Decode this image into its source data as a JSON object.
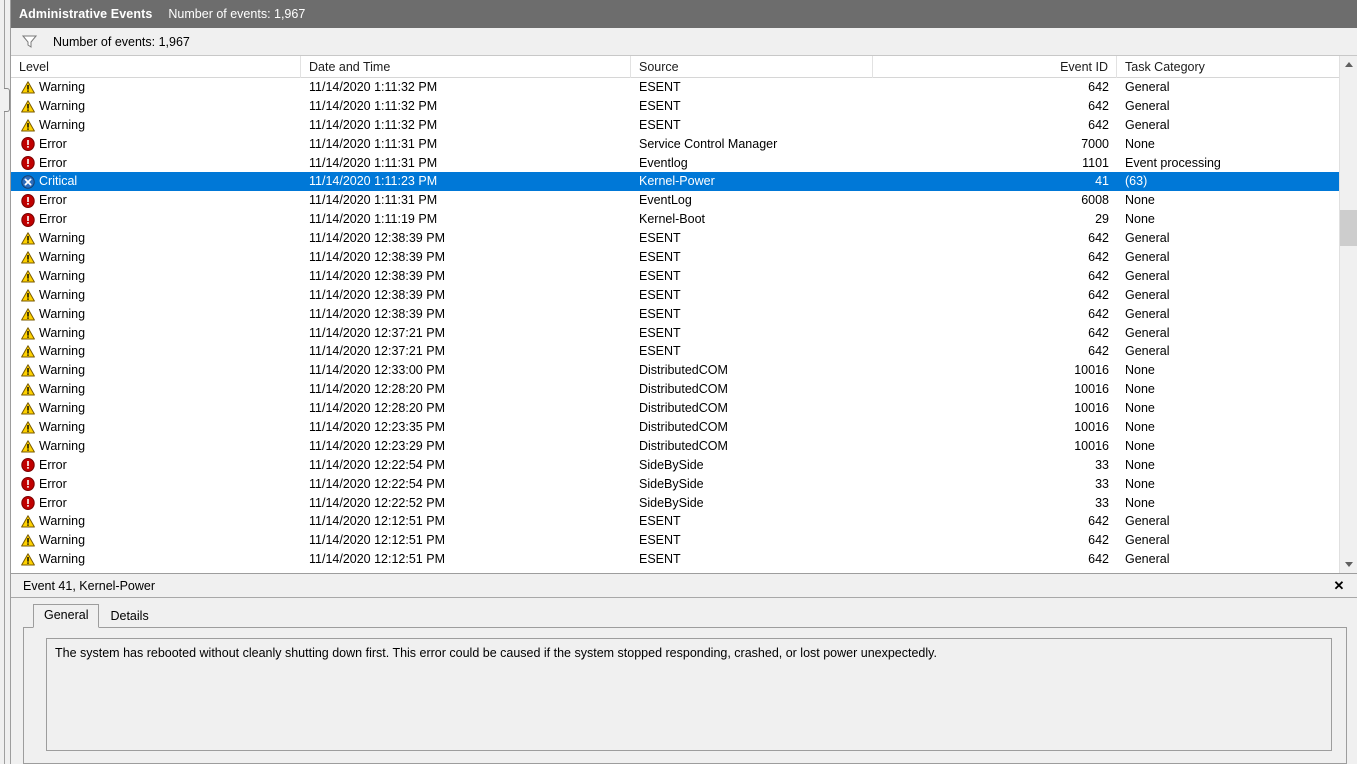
{
  "titlebar": {
    "title": "Administrative Events",
    "subtitle": "Number of events: 1,967"
  },
  "filterbar": {
    "icon": "filter-funnel-icon",
    "count_label": "Number of events: 1,967"
  },
  "grid": {
    "columns": [
      {
        "key": "level",
        "label": "Level",
        "align": "left"
      },
      {
        "key": "date",
        "label": "Date and Time",
        "align": "left"
      },
      {
        "key": "source",
        "label": "Source",
        "align": "left"
      },
      {
        "key": "eventid",
        "label": "Event ID",
        "align": "right"
      },
      {
        "key": "task",
        "label": "Task Category",
        "align": "left"
      }
    ],
    "rows": [
      {
        "level": "Warning",
        "icon": "warning-icon",
        "date": "11/14/2020 1:11:32 PM",
        "source": "ESENT",
        "eventid": "642",
        "task": "General",
        "selected": false
      },
      {
        "level": "Warning",
        "icon": "warning-icon",
        "date": "11/14/2020 1:11:32 PM",
        "source": "ESENT",
        "eventid": "642",
        "task": "General",
        "selected": false
      },
      {
        "level": "Warning",
        "icon": "warning-icon",
        "date": "11/14/2020 1:11:32 PM",
        "source": "ESENT",
        "eventid": "642",
        "task": "General",
        "selected": false
      },
      {
        "level": "Error",
        "icon": "error-icon",
        "date": "11/14/2020 1:11:31 PM",
        "source": "Service Control Manager",
        "eventid": "7000",
        "task": "None",
        "selected": false
      },
      {
        "level": "Error",
        "icon": "error-icon",
        "date": "11/14/2020 1:11:31 PM",
        "source": "Eventlog",
        "eventid": "1101",
        "task": "Event processing",
        "selected": false
      },
      {
        "level": "Critical",
        "icon": "critical-icon",
        "date": "11/14/2020 1:11:23 PM",
        "source": "Kernel-Power",
        "eventid": "41",
        "task": "(63)",
        "selected": true
      },
      {
        "level": "Error",
        "icon": "error-icon",
        "date": "11/14/2020 1:11:31 PM",
        "source": "EventLog",
        "eventid": "6008",
        "task": "None",
        "selected": false
      },
      {
        "level": "Error",
        "icon": "error-icon",
        "date": "11/14/2020 1:11:19 PM",
        "source": "Kernel-Boot",
        "eventid": "29",
        "task": "None",
        "selected": false
      },
      {
        "level": "Warning",
        "icon": "warning-icon",
        "date": "11/14/2020 12:38:39 PM",
        "source": "ESENT",
        "eventid": "642",
        "task": "General",
        "selected": false
      },
      {
        "level": "Warning",
        "icon": "warning-icon",
        "date": "11/14/2020 12:38:39 PM",
        "source": "ESENT",
        "eventid": "642",
        "task": "General",
        "selected": false
      },
      {
        "level": "Warning",
        "icon": "warning-icon",
        "date": "11/14/2020 12:38:39 PM",
        "source": "ESENT",
        "eventid": "642",
        "task": "General",
        "selected": false
      },
      {
        "level": "Warning",
        "icon": "warning-icon",
        "date": "11/14/2020 12:38:39 PM",
        "source": "ESENT",
        "eventid": "642",
        "task": "General",
        "selected": false
      },
      {
        "level": "Warning",
        "icon": "warning-icon",
        "date": "11/14/2020 12:38:39 PM",
        "source": "ESENT",
        "eventid": "642",
        "task": "General",
        "selected": false
      },
      {
        "level": "Warning",
        "icon": "warning-icon",
        "date": "11/14/2020 12:37:21 PM",
        "source": "ESENT",
        "eventid": "642",
        "task": "General",
        "selected": false
      },
      {
        "level": "Warning",
        "icon": "warning-icon",
        "date": "11/14/2020 12:37:21 PM",
        "source": "ESENT",
        "eventid": "642",
        "task": "General",
        "selected": false
      },
      {
        "level": "Warning",
        "icon": "warning-icon",
        "date": "11/14/2020 12:33:00 PM",
        "source": "DistributedCOM",
        "eventid": "10016",
        "task": "None",
        "selected": false
      },
      {
        "level": "Warning",
        "icon": "warning-icon",
        "date": "11/14/2020 12:28:20 PM",
        "source": "DistributedCOM",
        "eventid": "10016",
        "task": "None",
        "selected": false
      },
      {
        "level": "Warning",
        "icon": "warning-icon",
        "date": "11/14/2020 12:28:20 PM",
        "source": "DistributedCOM",
        "eventid": "10016",
        "task": "None",
        "selected": false
      },
      {
        "level": "Warning",
        "icon": "warning-icon",
        "date": "11/14/2020 12:23:35 PM",
        "source": "DistributedCOM",
        "eventid": "10016",
        "task": "None",
        "selected": false
      },
      {
        "level": "Warning",
        "icon": "warning-icon",
        "date": "11/14/2020 12:23:29 PM",
        "source": "DistributedCOM",
        "eventid": "10016",
        "task": "None",
        "selected": false
      },
      {
        "level": "Error",
        "icon": "error-icon",
        "date": "11/14/2020 12:22:54 PM",
        "source": "SideBySide",
        "eventid": "33",
        "task": "None",
        "selected": false
      },
      {
        "level": "Error",
        "icon": "error-icon",
        "date": "11/14/2020 12:22:54 PM",
        "source": "SideBySide",
        "eventid": "33",
        "task": "None",
        "selected": false
      },
      {
        "level": "Error",
        "icon": "error-icon",
        "date": "11/14/2020 12:22:52 PM",
        "source": "SideBySide",
        "eventid": "33",
        "task": "None",
        "selected": false
      },
      {
        "level": "Warning",
        "icon": "warning-icon",
        "date": "11/14/2020 12:12:51 PM",
        "source": "ESENT",
        "eventid": "642",
        "task": "General",
        "selected": false
      },
      {
        "level": "Warning",
        "icon": "warning-icon",
        "date": "11/14/2020 12:12:51 PM",
        "source": "ESENT",
        "eventid": "642",
        "task": "General",
        "selected": false
      },
      {
        "level": "Warning",
        "icon": "warning-icon",
        "date": "11/14/2020 12:12:51 PM",
        "source": "ESENT",
        "eventid": "642",
        "task": "General",
        "selected": false
      }
    ]
  },
  "detail": {
    "header_title": "Event 41, Kernel-Power",
    "close_label": "✕",
    "tabs": [
      {
        "label": "General",
        "active": true
      },
      {
        "label": "Details",
        "active": false
      }
    ],
    "message": "The system has rebooted without cleanly shutting down first. This error could be caused if the system stopped responding, crashed, or lost power unexpectedly."
  },
  "scrollbar": {
    "up_icon": "chevron-up-icon",
    "down_icon": "chevron-down-icon"
  },
  "colors": {
    "selection": "#0078d7",
    "titlebar": "#6d6d6d",
    "warning": "#ffd200",
    "error": "#c00000",
    "critical": "#2b6dbd"
  }
}
